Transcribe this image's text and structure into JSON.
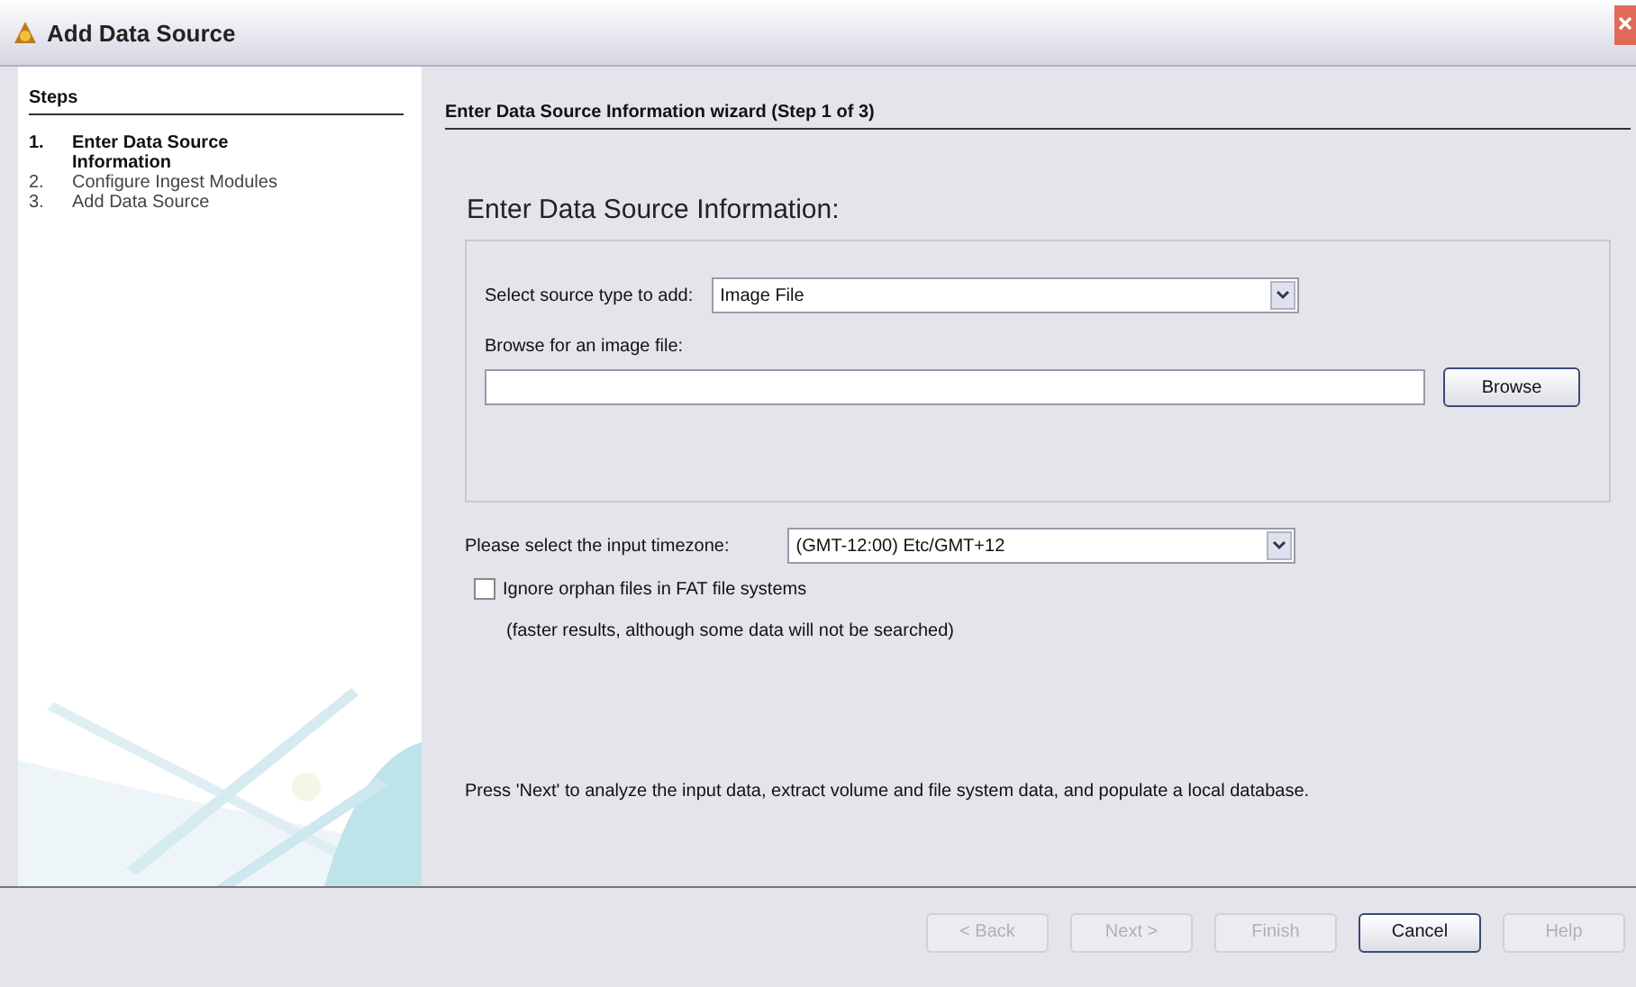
{
  "window": {
    "title": "Add Data Source"
  },
  "steps": {
    "heading": "Steps",
    "items": [
      {
        "number": "1.",
        "label": "Enter Data Source Information",
        "selected": true
      },
      {
        "number": "2.",
        "label": "Configure Ingest Modules",
        "selected": false
      },
      {
        "number": "3.",
        "label": "Add Data Source",
        "selected": false
      }
    ]
  },
  "panel": {
    "heading": "Enter Data Source Information wizard (Step 1 of 3)",
    "title": "Enter Data Source Information:",
    "source_type": {
      "label": "Select source type to add:",
      "value": "Image File"
    },
    "browse_label": "Browse for an image file:",
    "browse_button": "Browse",
    "timezone": {
      "label": "Please select the input timezone:",
      "value": "(GMT-12:00) Etc/GMT+12"
    },
    "orphan": {
      "label": "Ignore orphan files in FAT file systems",
      "checked": false
    },
    "orphan_note": "(faster results, although some data will not be searched)",
    "hint": "Press 'Next' to analyze the input data, extract volume and file system data, and populate a local database."
  },
  "buttons": [
    {
      "label": "< Back",
      "disabled": true
    },
    {
      "label": "Next >",
      "disabled": true
    },
    {
      "label": "Finish",
      "disabled": true
    },
    {
      "label": "Cancel",
      "disabled": false
    },
    {
      "label": "Help",
      "disabled": true
    }
  ]
}
